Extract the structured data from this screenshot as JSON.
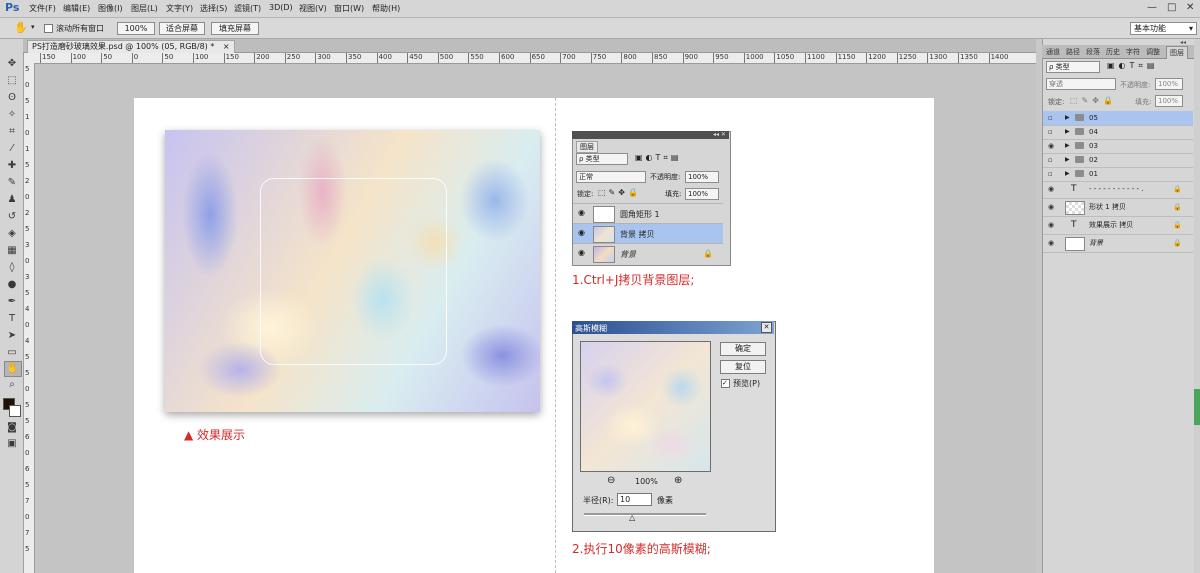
{
  "app": {
    "logo": "Ps"
  },
  "menu": [
    "文件(F)",
    "编辑(E)",
    "图像(I)",
    "图层(L)",
    "文字(Y)",
    "选择(S)",
    "滤镜(T)",
    "3D(D)",
    "视图(V)",
    "窗口(W)",
    "帮助(H)"
  ],
  "options": {
    "scroll_all_label": "滚动所有窗口",
    "zoom_value": "100%",
    "fit_screen": "适合屏幕",
    "fill_screen": "填充屏幕",
    "workspace": "基本功能"
  },
  "document": {
    "tab_title": "PS打造磨砂玻璃效果.psd @ 100% (05, RGB/8) *",
    "tab_close": "×"
  },
  "ruler": {
    "h_labels": [
      "150",
      "100",
      "50",
      "0",
      "50",
      "100",
      "150",
      "200",
      "250",
      "300",
      "350",
      "400",
      "450",
      "500",
      "550",
      "600",
      "650",
      "700",
      "750",
      "800",
      "850",
      "900",
      "950",
      "1000",
      "1050",
      "1100",
      "1150",
      "1200",
      "1250",
      "1300",
      "1350",
      "1400"
    ],
    "v_labels": [
      "5",
      "0",
      "5",
      "1",
      "0",
      "1",
      "5",
      "2",
      "0",
      "2",
      "5",
      "3",
      "0",
      "3",
      "5",
      "4",
      "0",
      "4",
      "5",
      "5",
      "0",
      "5",
      "5",
      "6",
      "0",
      "6",
      "5",
      "7",
      "0",
      "7",
      "5"
    ]
  },
  "canvas": {
    "effect_caption": "▲ 效果展示",
    "step1": "1.Ctrl+J拷贝背景图层;",
    "step2": "2.执行10像素的高斯模糊;"
  },
  "mini_layers": {
    "tab": "图层",
    "kind": "ρ 类型",
    "blend": "正常",
    "opacity_label": "不透明度:",
    "opacity_value": "100%",
    "lock_label": "锁定:",
    "fill_label": "填充:",
    "fill_value": "100%",
    "rows": [
      {
        "name": "圆角矩形 1",
        "selected": false
      },
      {
        "name": "背景 拷贝",
        "selected": true
      },
      {
        "name": "背景",
        "selected": false
      }
    ]
  },
  "gaussian": {
    "title": "高斯模糊",
    "ok": "确定",
    "reset": "复位",
    "preview_label": "预览(P)",
    "zoom": "100%",
    "radius_label": "半径(R):",
    "radius_value": "10",
    "unit": "像素"
  },
  "right_panel": {
    "tabs": [
      "通道",
      "路径",
      "段落",
      "历史",
      "字符",
      "调整",
      "图层"
    ],
    "kind": "ρ 类型",
    "blend": "穿透",
    "opacity_label": "不透明度:",
    "opacity_value": "100%",
    "lock_label": "锁定:",
    "fill_label": "填充:",
    "fill_value": "100%",
    "layers": [
      {
        "name": "05",
        "type": "group",
        "visible": false,
        "selected": true
      },
      {
        "name": "04",
        "type": "group",
        "visible": false,
        "selected": false
      },
      {
        "name": "03",
        "type": "group",
        "visible": true,
        "selected": false
      },
      {
        "name": "02",
        "type": "group",
        "visible": false,
        "selected": false
      },
      {
        "name": "01",
        "type": "group",
        "visible": false,
        "selected": false
      },
      {
        "name": "- - - - - - - - - - - .",
        "type": "text",
        "visible": true,
        "selected": false
      },
      {
        "name": "形状 1 拷贝",
        "type": "shape",
        "visible": true,
        "selected": false
      },
      {
        "name": "效果展示 拷贝",
        "type": "text",
        "visible": true,
        "selected": false
      },
      {
        "name": "背景",
        "type": "image",
        "visible": true,
        "selected": false
      }
    ]
  },
  "colors": {
    "accent_red": "#d42b2b",
    "selected_row": "#aac4f0"
  }
}
